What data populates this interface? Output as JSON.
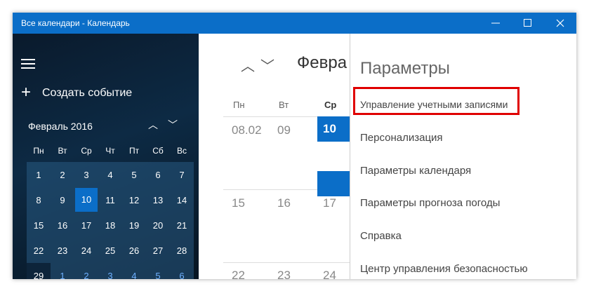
{
  "window": {
    "title": "Все календари - Календарь"
  },
  "sidebar": {
    "create_label": "Создать событие",
    "month": "Февраль 2016",
    "weekdays": [
      "Пн",
      "Вт",
      "Ср",
      "Чт",
      "Пт",
      "Сб",
      "Вс"
    ],
    "weeks": [
      [
        "1",
        "2",
        "3",
        "4",
        "5",
        "6",
        "7"
      ],
      [
        "8",
        "9",
        "10",
        "11",
        "12",
        "13",
        "14"
      ],
      [
        "15",
        "16",
        "17",
        "18",
        "19",
        "20",
        "21"
      ],
      [
        "22",
        "23",
        "24",
        "25",
        "26",
        "27",
        "28"
      ],
      [
        "29",
        "1",
        "2",
        "3",
        "4",
        "5",
        "6"
      ]
    ],
    "today": "10"
  },
  "main": {
    "month": "Февра",
    "day_headers": [
      "Пн",
      "Вт",
      "Ср"
    ],
    "rows": [
      [
        "08.02",
        "09",
        "10"
      ],
      [
        "15",
        "16",
        "17"
      ],
      [
        "22",
        "23",
        "24"
      ]
    ]
  },
  "settings": {
    "title": "Параметры",
    "items": [
      "Управление учетными записями",
      "Персонализация",
      "Параметры календаря",
      "Параметры прогноза погоды",
      "Справка",
      "Центр управления безопасностью"
    ]
  }
}
